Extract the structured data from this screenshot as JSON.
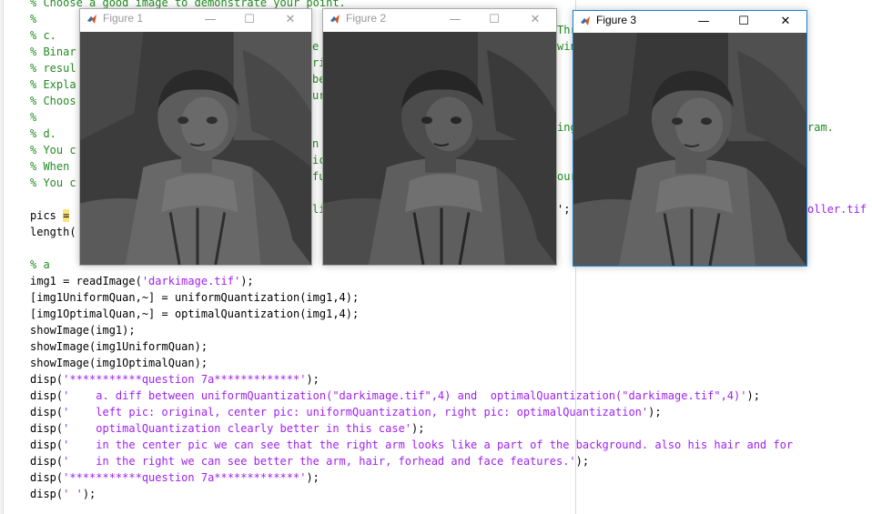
{
  "editor": {
    "lines": [
      {
        "parts": [
          {
            "t": "% Choose a good image to demonstrate your point.",
            "c": "cm"
          }
        ]
      },
      {
        "parts": [
          {
            "t": "%",
            "c": "cm"
          }
        ]
      },
      {
        "parts": [
          {
            "t": "% c.",
            "c": "cm"
          }
        ]
      },
      {
        "parts": [
          {
            "t": "% Binar",
            "c": "cm"
          }
        ]
      },
      {
        "parts": [
          {
            "t": "% resul",
            "c": "cm"
          }
        ]
      },
      {
        "parts": [
          {
            "t": "% Expla",
            "c": "cm"
          }
        ]
      },
      {
        "parts": [
          {
            "t": "% Choos",
            "c": "cm"
          }
        ]
      },
      {
        "parts": [
          {
            "t": "%",
            "c": "cm"
          }
        ]
      },
      {
        "parts": [
          {
            "t": "% d.",
            "c": "cm"
          }
        ]
      },
      {
        "parts": [
          {
            "t": "% You c",
            "c": "cm"
          }
        ]
      },
      {
        "parts": [
          {
            "t": "% When",
            "c": "cm"
          }
        ]
      },
      {
        "parts": [
          {
            "t": "% You c",
            "c": "cm"
          }
        ]
      },
      {
        "parts": [
          {
            "t": ""
          }
        ]
      },
      {
        "parts": [
          {
            "t": "pics "
          },
          {
            "t": "=",
            "c": "hl"
          }
        ]
      },
      {
        "parts": [
          {
            "t": "length("
          }
        ]
      },
      {
        "parts": [
          {
            "t": ""
          }
        ]
      },
      {
        "parts": [
          {
            "t": "% a",
            "c": "cm"
          }
        ]
      },
      {
        "parts": [
          {
            "t": "img1 = readImage("
          },
          {
            "t": "'darkimage.tif'",
            "c": "st"
          },
          {
            "t": ");"
          }
        ]
      },
      {
        "parts": [
          {
            "t": "[img1UniformQuan,~] = uniformQuantization(img1,4);"
          }
        ]
      },
      {
        "parts": [
          {
            "t": "[img1OptimalQuan,~] = optimalQuantization(img1,4);"
          }
        ]
      },
      {
        "parts": [
          {
            "t": "showImage(img1);"
          }
        ]
      },
      {
        "parts": [
          {
            "t": "showImage(img1UniformQuan);"
          }
        ]
      },
      {
        "parts": [
          {
            "t": "showImage(img1OptimalQuan);"
          }
        ]
      },
      {
        "parts": [
          {
            "t": "disp("
          },
          {
            "t": "'***********question 7a*************'",
            "c": "st"
          },
          {
            "t": ");"
          }
        ]
      },
      {
        "parts": [
          {
            "t": "disp("
          },
          {
            "t": "'    a. diff between uniformQuantization(\"darkimage.tif\",4) and  optimalQuantization(\"darkimage.tif\",4)'",
            "c": "st"
          },
          {
            "t": ");"
          }
        ]
      },
      {
        "parts": [
          {
            "t": "disp("
          },
          {
            "t": "'    left pic: original, center pic: uniformQuantization, right pic: optimalQuantization'",
            "c": "st"
          },
          {
            "t": ");"
          }
        ]
      },
      {
        "parts": [
          {
            "t": "disp("
          },
          {
            "t": "'    optimalQuantization clearly better in this case'",
            "c": "st"
          },
          {
            "t": ");"
          }
        ]
      },
      {
        "parts": [
          {
            "t": "disp("
          },
          {
            "t": "'    in the center pic we can see that the right arm looks like a part of the background. also his hair and for",
            "c": "st"
          }
        ]
      },
      {
        "parts": [
          {
            "t": "disp("
          },
          {
            "t": "'    in the right we can see better the arm, hair, forhead and face features.'",
            "c": "st"
          },
          {
            "t": ");"
          }
        ]
      },
      {
        "parts": [
          {
            "t": "disp("
          },
          {
            "t": "'***********question 7a*************'",
            "c": "st"
          },
          {
            "t": ");"
          }
        ]
      },
      {
        "parts": [
          {
            "t": "disp("
          },
          {
            "t": "' '",
            "c": "st"
          },
          {
            "t": ");"
          }
        ]
      }
    ],
    "peek": [
      {
        "text": "Thr",
        "c": "cm"
      },
      {
        "text": "win",
        "c": "cm"
      },
      {
        "text": "ing",
        "c": "cm"
      },
      {
        "text": "ram.",
        "c": "cm"
      },
      {
        "text": "our",
        "c": "cm"
      },
      {
        "text": "';",
        "c": ""
      },
      {
        "text": "oller.tif",
        "c": "st"
      },
      {
        "text": "e",
        "c": "cm"
      },
      {
        "text": "ri",
        "c": "cm"
      },
      {
        "text": "be",
        "c": "cm"
      },
      {
        "text": "ur",
        "c": "cm"
      },
      {
        "text": "n",
        "c": "cm"
      },
      {
        "text": "ic",
        "c": "cm"
      },
      {
        "text": "fu",
        "c": "cm"
      },
      {
        "text": "li",
        "c": "cm"
      }
    ]
  },
  "figures": [
    {
      "title": "Figure 1",
      "minimize": "—",
      "maximize": "☐",
      "close": "✕",
      "variant": "original",
      "active": false
    },
    {
      "title": "Figure 2",
      "minimize": "—",
      "maximize": "☐",
      "close": "✕",
      "variant": "uniform",
      "active": false
    },
    {
      "title": "Figure 3",
      "minimize": "—",
      "maximize": "☐",
      "close": "✕",
      "variant": "optimal",
      "active": true
    }
  ],
  "colors": {
    "comment": "#228b22",
    "string": "#a020f0",
    "active_border": "#1883d7"
  }
}
